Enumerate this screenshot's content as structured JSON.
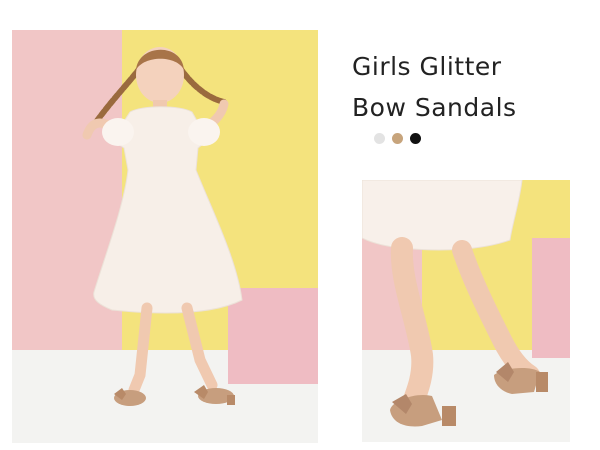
{
  "product": {
    "title_line1": "Girls Glitter",
    "title_line2": "Bow Sandals"
  },
  "color_swatches": [
    {
      "name": "silver",
      "color": "#e3e3e3"
    },
    {
      "name": "champagne",
      "color": "#c7a47c"
    },
    {
      "name": "black",
      "color": "#111111"
    }
  ],
  "photos": [
    {
      "name": "girl-full-length-photo",
      "subject": "girl in white dress with braided pigtails wearing glitter bow sandals"
    },
    {
      "name": "sandal-closeup-photo",
      "subject": "close-up of legs wearing rose gold glitter bow sandals"
    }
  ],
  "colors": {
    "backdrop_pink": "#f1c6c6",
    "backdrop_yellow": "#f4e37d",
    "floor": "#f3f3f1",
    "dress": "#f6ede6",
    "sandal": "#c79e7e"
  }
}
